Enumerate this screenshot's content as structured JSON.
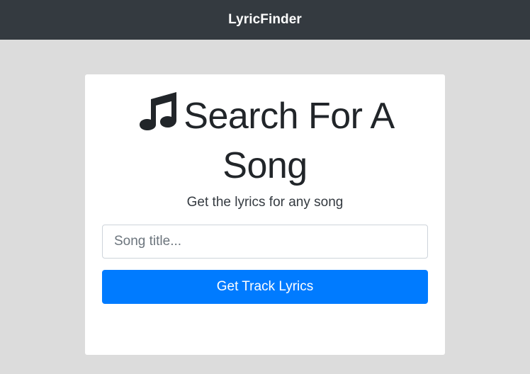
{
  "navbar": {
    "brand": "LyricFinder"
  },
  "search_card": {
    "icon": "music-note-icon",
    "title": "Search For A Song",
    "subtitle": "Get the lyrics for any song",
    "input": {
      "placeholder": "Song title...",
      "value": ""
    },
    "submit_label": "Get Track Lyrics"
  },
  "colors": {
    "navbar_bg": "#343a40",
    "page_bg": "#dcdcdc",
    "card_bg": "#ffffff",
    "primary_button": "#007bff"
  }
}
